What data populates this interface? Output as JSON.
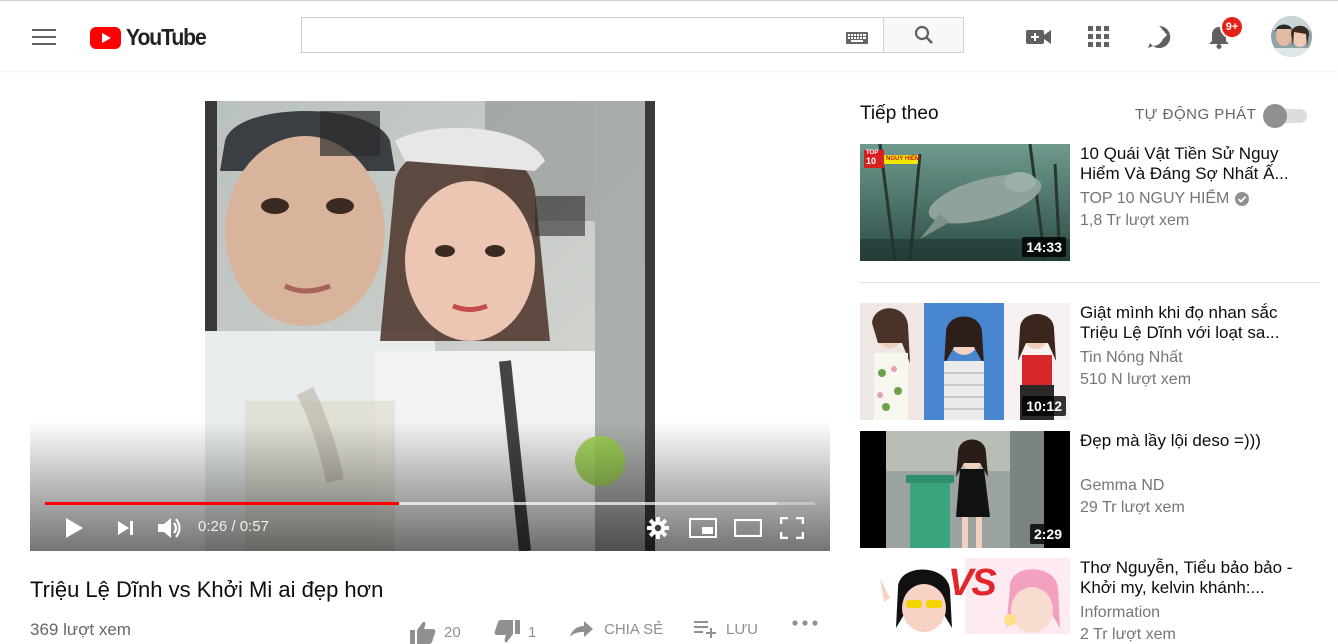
{
  "header": {
    "logo_text": "YouTube",
    "search_value": "",
    "notification_count": "9+",
    "icons": [
      "menu-icon",
      "keyboard-icon",
      "search-icon",
      "create-video-icon",
      "apps-icon",
      "share-icon",
      "bell-icon"
    ],
    "brand_color": "#ff0000"
  },
  "player": {
    "current_time": "0:26",
    "separator": " / ",
    "duration": "0:57",
    "played_fraction": 0.46,
    "buffered_fraction": 0.95
  },
  "video": {
    "title": "Triệu Lệ Dĩnh vs Khởi Mi ai đẹp hơn",
    "views": "369 lượt xem",
    "likes": "20",
    "dislikes": "1",
    "share_label": "CHIA SẺ",
    "save_label": "LƯU"
  },
  "sidebar": {
    "up_next_label": "Tiếp theo",
    "autoplay_label": "TỰ ĐỘNG PHÁT",
    "autoplay_on": false,
    "items": [
      {
        "title": "10 Quái Vật Tiền Sử Nguy Hiểm Và Đáng Sợ Nhất Ấ...",
        "channel": "TOP 10 NGUY HIỂM",
        "verified": true,
        "views": "1,8 Tr lượt xem",
        "duration": "14:33",
        "thumb_badge_top": "TOP",
        "thumb_badge_num": "10",
        "thumb_badge_text": "NGUY HIỂM"
      },
      {
        "title": "Giật mình khi đọ nhan sắc Triệu Lệ Dĩnh với loạt sa...",
        "channel": "Tin Nóng Nhất",
        "verified": false,
        "views": "510 N lượt xem",
        "duration": "10:12"
      },
      {
        "title": "Đẹp mà lầy lội deso =)))",
        "channel": "Gemma ND",
        "verified": false,
        "views": "29 Tr lượt xem",
        "duration": "2:29"
      },
      {
        "title": "Thơ Nguyễn, Tiểu bảo bảo - Khởi my, kelvin khánh:...",
        "channel": "Information",
        "verified": false,
        "views": "2 Tr lượt xem",
        "duration": "",
        "thumb_text": "VS"
      }
    ]
  }
}
